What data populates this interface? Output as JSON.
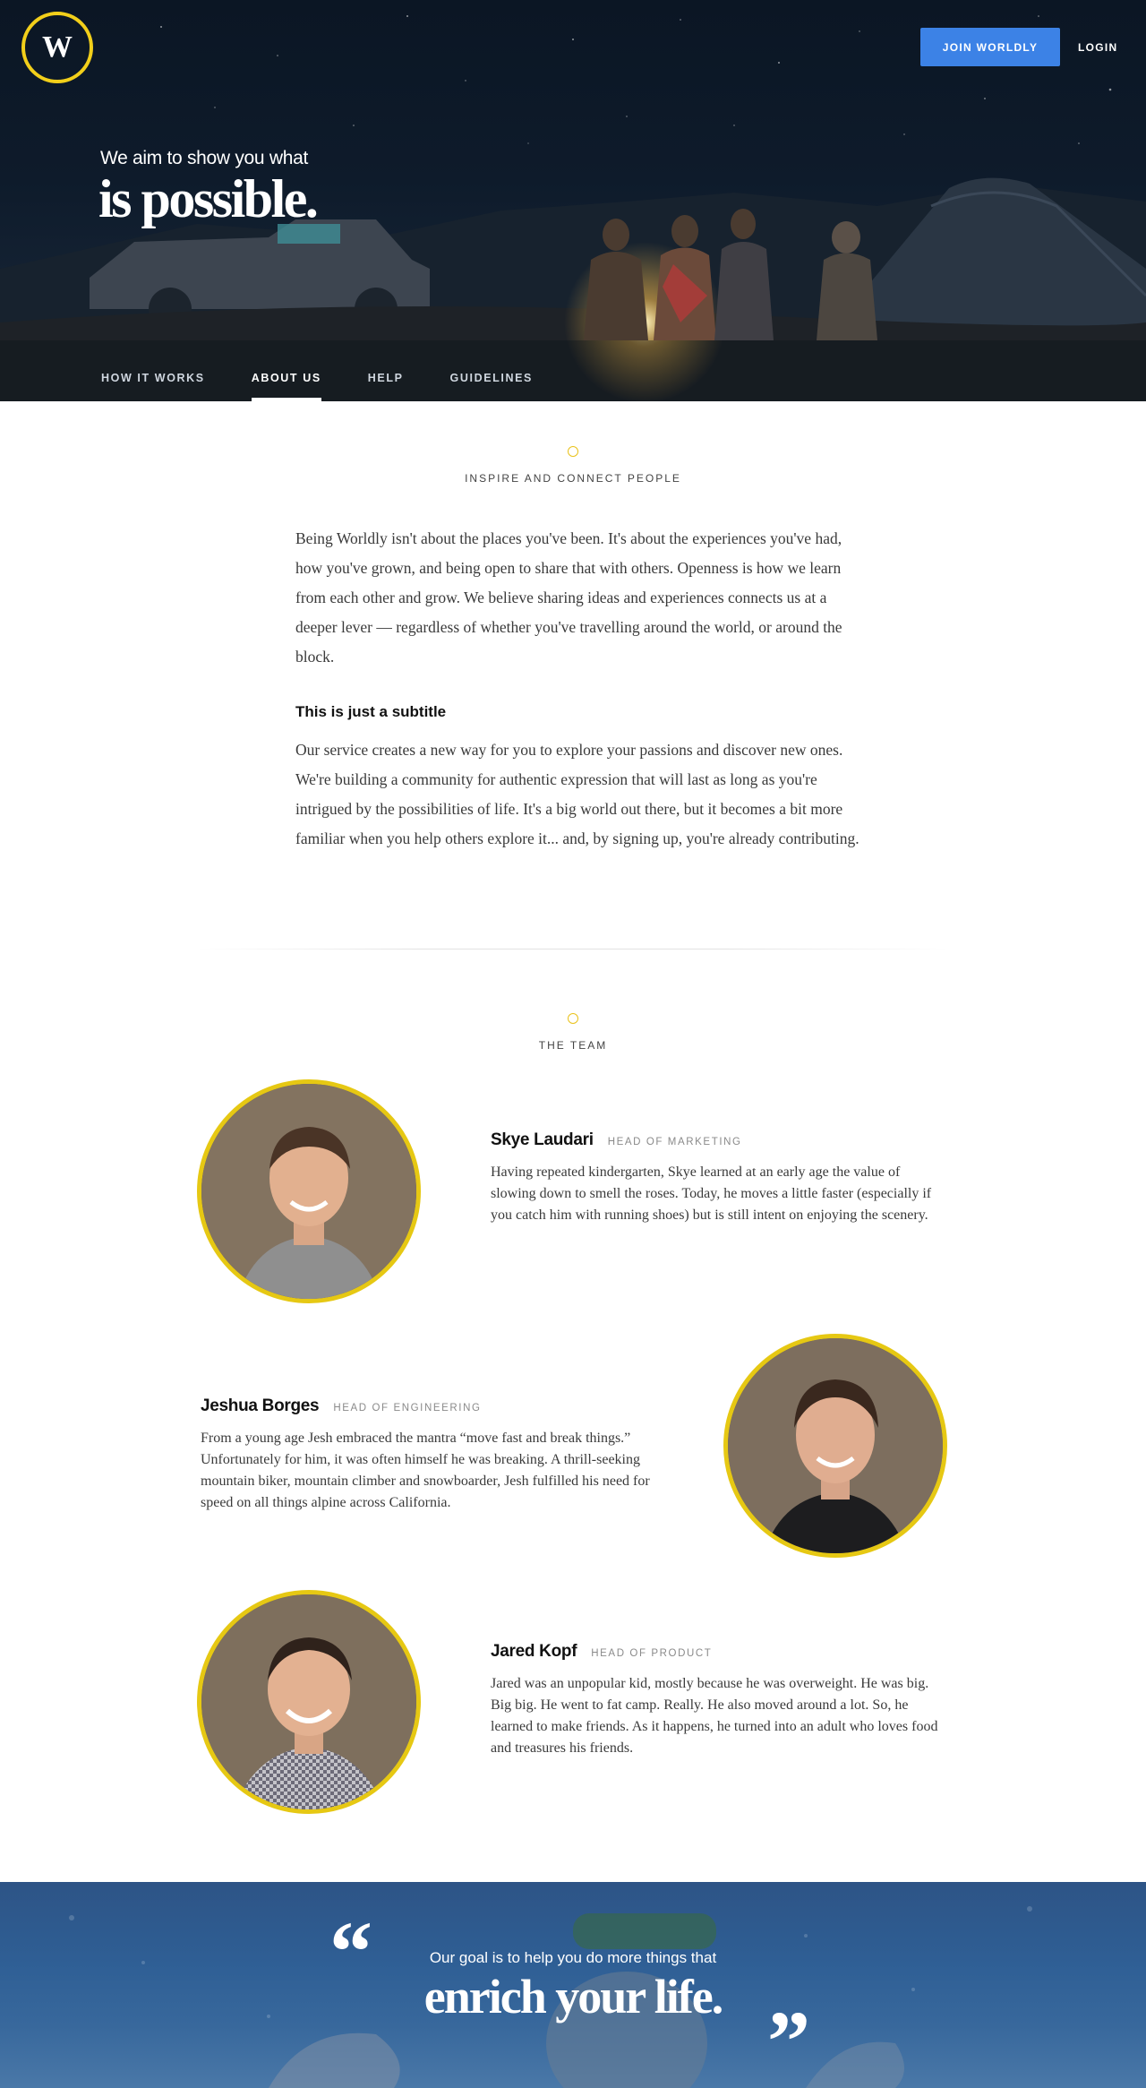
{
  "header": {
    "logo_letter": "W",
    "join_label": "JOIN WORLDLY",
    "login_label": "LOGIN",
    "tagline_small": "We aim to show you what",
    "tagline_big": "is possible.",
    "nav": [
      {
        "label": "HOW IT WORKS",
        "active": false
      },
      {
        "label": "ABOUT US",
        "active": true
      },
      {
        "label": "HELP",
        "active": false
      },
      {
        "label": "GUIDELINES",
        "active": false
      }
    ]
  },
  "mission": {
    "label": "INSPIRE AND CONNECT PEOPLE",
    "paragraph1": "Being Worldly isn't about the places you've been. It's about the experiences you've had, how you've grown, and being open to share that with others. Openness is how we learn from each other and grow. We believe sharing ideas and experiences connects us at a deeper lever — regardless of whether you've travelling around the world, or around the block.",
    "subtitle": "This is just a subtitle",
    "paragraph2": "Our service creates a new way for you to explore your passions and discover new ones. We're building a community for authentic expression that will last as long as you're intrigued by the possibilities of life. It's a big world out there, but it becomes a bit more familiar when you help others explore it... and, by signing up, you're already contributing."
  },
  "team": {
    "label": "THE TEAM",
    "members": [
      {
        "name": "Skye Laudari",
        "role": "HEAD OF MARKETING",
        "bio": "Having repeated kindergarten, Skye learned at an early age the value of slowing down to smell the roses. Today, he moves a little faster (especially if you catch him with running shoes) but is still intent on enjoying the scenery."
      },
      {
        "name": "Jeshua Borges",
        "role": "HEAD OF ENGINEERING",
        "bio": "From a young age Jesh embraced the mantra “move fast and break things.” Unfortunately for him, it was often himself he was breaking. A thrill-seeking mountain biker, mountain climber and snowboarder, Jesh fulfilled his need for speed on all things alpine across California."
      },
      {
        "name": "Jared Kopf",
        "role": "HEAD OF PRODUCT",
        "bio": "Jared was an unpopular kid, mostly because he was overweight. He was big. Big big. He went to fat camp. Really. He also moved around a lot. So, he learned to make friends. As it happens, he turned into an adult who loves food and treasures his friends."
      }
    ]
  },
  "quote": {
    "open_mark": "“",
    "close_mark": "”",
    "small": "Our goal is to help you do more things that",
    "big": "enrich your life."
  },
  "colors": {
    "accent_yellow": "#f2cf1a",
    "button_blue": "#3c82e6",
    "hero_dark": "#0e1b2b",
    "quote_blue": "#2f5f95"
  }
}
